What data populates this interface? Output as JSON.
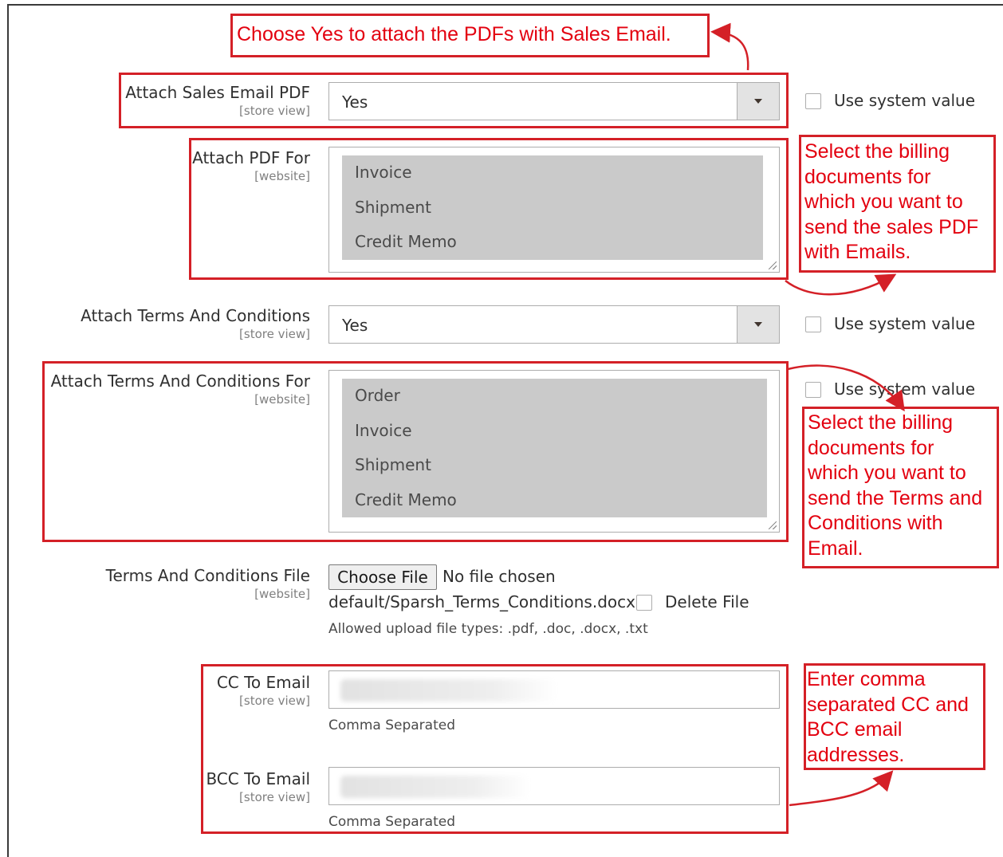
{
  "annotations": {
    "top_note": "Choose Yes to attach the PDFs with Sales Email.",
    "pdf_for_note": [
      "Select the billing",
      "documents for",
      "which you want to",
      "send the sales PDF",
      "with Emails."
    ],
    "terms_for_note": [
      "Select the billing",
      "documents for",
      "which you want to",
      "send the Terms and",
      "Conditions with",
      "Email."
    ],
    "email_note": [
      "Enter comma",
      "separated CC and",
      "BCC email",
      "addresses."
    ]
  },
  "fields": {
    "attach_sales_pdf": {
      "label": "Attach Sales Email PDF",
      "scope": "[store view]",
      "value": "Yes",
      "use_system": "Use system value"
    },
    "attach_pdf_for": {
      "label": "Attach PDF For",
      "scope": "[website]",
      "options": [
        "Invoice",
        "Shipment",
        "Credit Memo"
      ]
    },
    "attach_terms": {
      "label": "Attach Terms And Conditions",
      "scope": "[store view]",
      "value": "Yes",
      "use_system": "Use system value"
    },
    "attach_terms_for": {
      "label": "Attach Terms And Conditions For",
      "scope": "[website]",
      "options": [
        "Order",
        "Invoice",
        "Shipment",
        "Credit Memo"
      ],
      "use_system": "Use system value"
    },
    "terms_file": {
      "label": "Terms And Conditions File",
      "scope": "[website]",
      "button": "Choose File",
      "status": "No file chosen",
      "current_file": "default/Sparsh_Terms_Conditions.docx",
      "delete_label": "Delete File",
      "allowed": "Allowed upload file types: .pdf, .doc, .docx, .txt"
    },
    "cc_email": {
      "label": "CC To Email",
      "scope": "[store view]",
      "note": "Comma Separated"
    },
    "bcc_email": {
      "label": "BCC To Email",
      "scope": "[store view]",
      "note": "Comma Separated"
    }
  },
  "colors": {
    "annotation_red": "#d42027",
    "annotation_text": "#e3000f",
    "option_bg": "#cacaca"
  }
}
